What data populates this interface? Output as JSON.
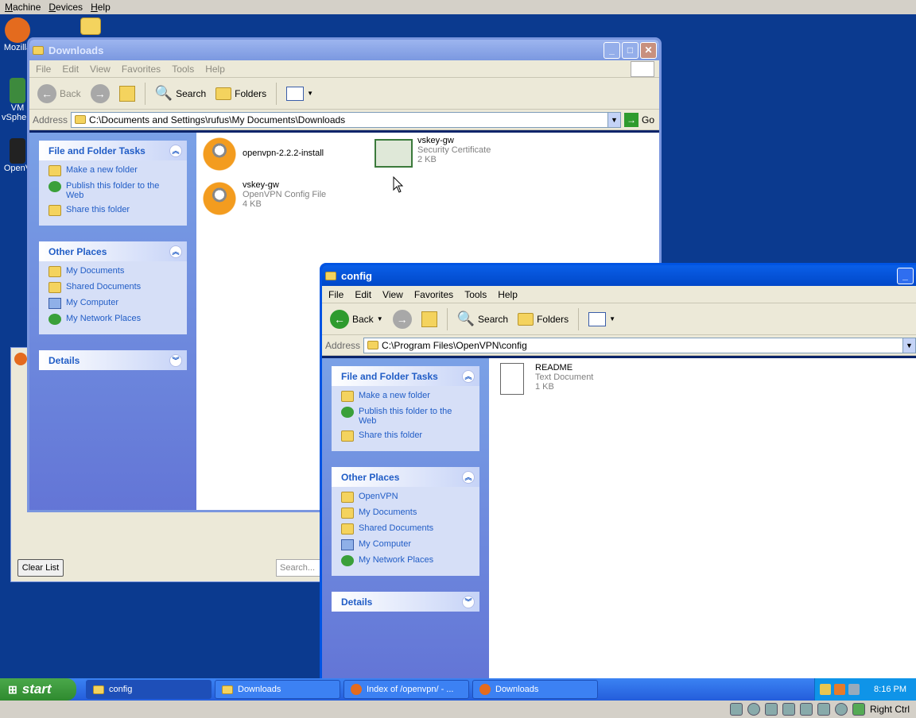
{
  "vbox_menu": [
    "Machine",
    "Devices",
    "Help"
  ],
  "desktop_icons": [
    "Mozilla",
    "VM vSphere",
    "OpenV"
  ],
  "downloads_window": {
    "title": "Downloads",
    "menu": [
      "File",
      "Edit",
      "View",
      "Favorites",
      "Tools",
      "Help"
    ],
    "toolbar": {
      "back": "Back",
      "search": "Search",
      "folders": "Folders"
    },
    "address_label": "Address",
    "address": "C:\\Documents and Settings\\rufus\\My Documents\\Downloads",
    "go": "Go",
    "tasks_title": "File and Folder Tasks",
    "tasks": [
      "Make a new folder",
      "Publish this folder to the Web",
      "Share this folder"
    ],
    "places_title": "Other Places",
    "places": [
      "My Documents",
      "Shared Documents",
      "My Computer",
      "My Network Places"
    ],
    "details_title": "Details",
    "files": [
      {
        "name": "openvpn-2.2.2-install",
        "type": "",
        "size": ""
      },
      {
        "name": "vskey-gw",
        "type": "Security Certificate",
        "size": "2 KB"
      },
      {
        "name": "vskey-gw",
        "type": "OpenVPN Config File",
        "size": "4 KB"
      }
    ]
  },
  "config_window": {
    "title": "config",
    "menu": [
      "File",
      "Edit",
      "View",
      "Favorites",
      "Tools",
      "Help"
    ],
    "toolbar": {
      "back": "Back",
      "search": "Search",
      "folders": "Folders"
    },
    "address_label": "Address",
    "address": "C:\\Program Files\\OpenVPN\\config",
    "tasks_title": "File and Folder Tasks",
    "tasks": [
      "Make a new folder",
      "Publish this folder to the Web",
      "Share this folder"
    ],
    "places_title": "Other Places",
    "places": [
      "OpenVPN",
      "My Documents",
      "Shared Documents",
      "My Computer",
      "My Network Places"
    ],
    "details_title": "Details",
    "files": [
      {
        "name": "README",
        "type": "Text Document",
        "size": "1 KB"
      }
    ]
  },
  "downloads_manager": {
    "clear_list": "Clear List",
    "search_placeholder": "Search..."
  },
  "taskbar": {
    "start": "start",
    "tasks": [
      "config",
      "Downloads",
      "Index of /openvpn/ - ...",
      "Downloads"
    ],
    "clock": "8:16 PM"
  },
  "vbox_status": {
    "host_key": "Right Ctrl"
  }
}
